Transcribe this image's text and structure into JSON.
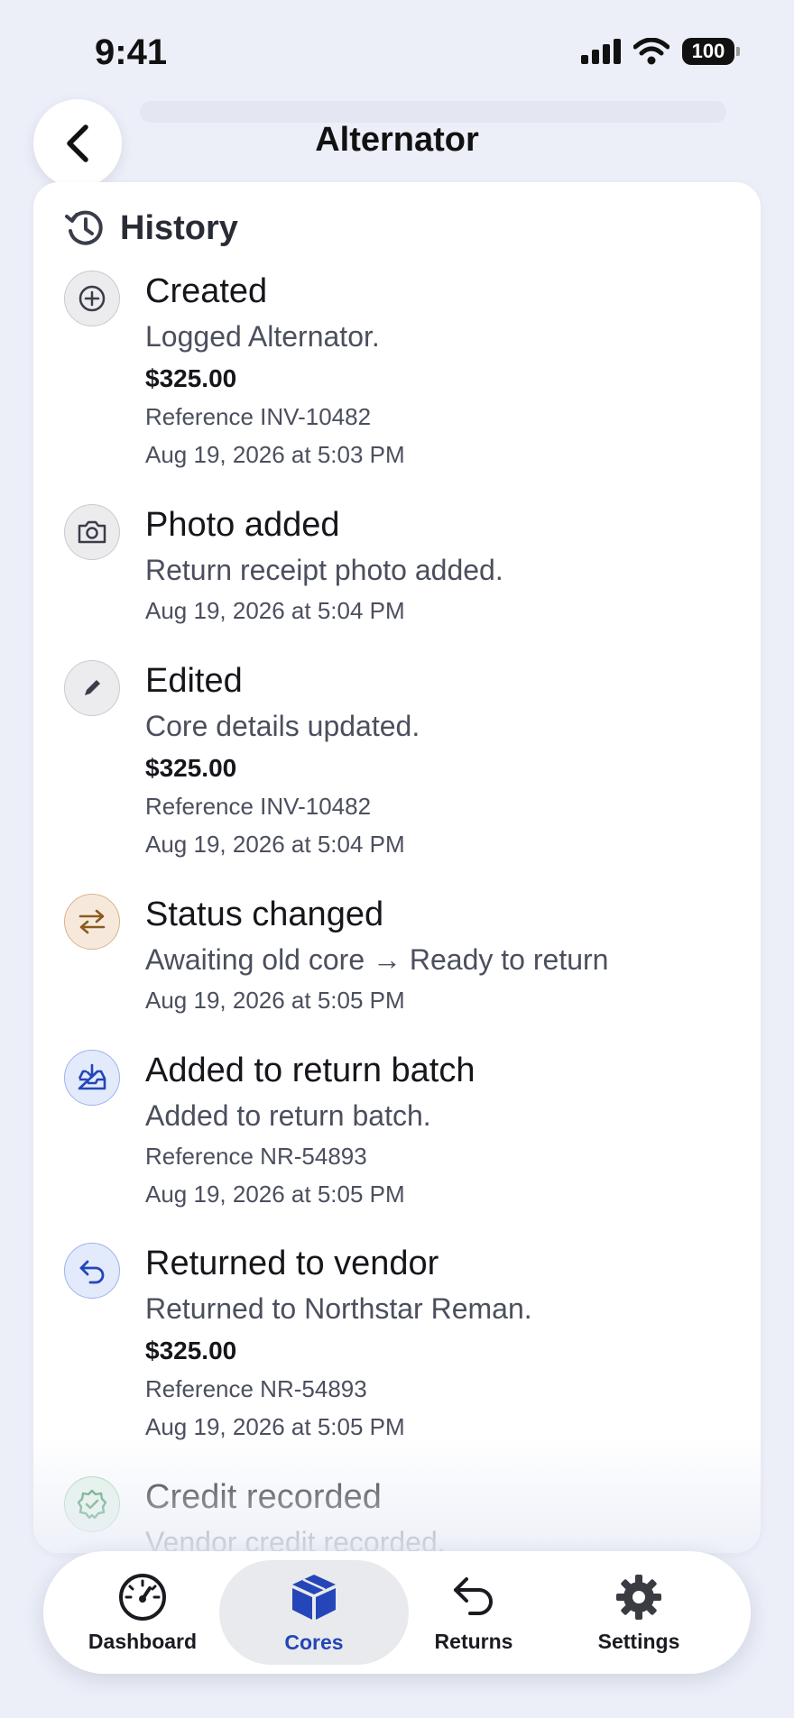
{
  "status": {
    "time": "9:41",
    "battery": "100"
  },
  "header": {
    "title": "Alternator"
  },
  "history": {
    "title": "History",
    "entries": [
      {
        "title": "Created",
        "description": "Logged Alternator.",
        "amount": "$325.00",
        "reference": "Reference INV-10482",
        "timestamp": "Aug 19, 2026 at 5:03 PM",
        "icon": "plus-circle-icon"
      },
      {
        "title": "Photo added",
        "description": "Return receipt photo added.",
        "timestamp": "Aug 19, 2026 at 5:04 PM",
        "icon": "camera-icon"
      },
      {
        "title": "Edited",
        "description": "Core details updated.",
        "amount": "$325.00",
        "reference": "Reference INV-10482",
        "timestamp": "Aug 19, 2026 at 5:04 PM",
        "icon": "pencil-icon"
      },
      {
        "title": "Status changed",
        "description": "Awaiting old core → Ready to return",
        "timestamp": "Aug 19, 2026 at 5:05 PM",
        "icon": "swap-arrows-icon"
      },
      {
        "title": "Added to return batch",
        "description": "Added to return batch.",
        "reference": "Reference NR-54893",
        "timestamp": "Aug 19, 2026 at 5:05 PM",
        "icon": "tray-download-icon"
      },
      {
        "title": "Returned to vendor",
        "description": "Returned to Northstar Reman.",
        "amount": "$325.00",
        "reference": "Reference NR-54893",
        "timestamp": "Aug 19, 2026 at 5:05 PM",
        "icon": "return-arrow-icon"
      },
      {
        "title": "Credit recorded",
        "description": "Vendor credit recorded.",
        "icon": "check-seal-icon"
      }
    ]
  },
  "tabbar": {
    "tabs": [
      {
        "label": "Dashboard",
        "icon": "gauge-icon"
      },
      {
        "label": "Cores",
        "icon": "box-icon",
        "active": true
      },
      {
        "label": "Returns",
        "icon": "return-arrow-icon"
      },
      {
        "label": "Settings",
        "icon": "gear-icon"
      }
    ]
  },
  "colors": {
    "accent": "#2446b8",
    "background": "#eceff8"
  }
}
